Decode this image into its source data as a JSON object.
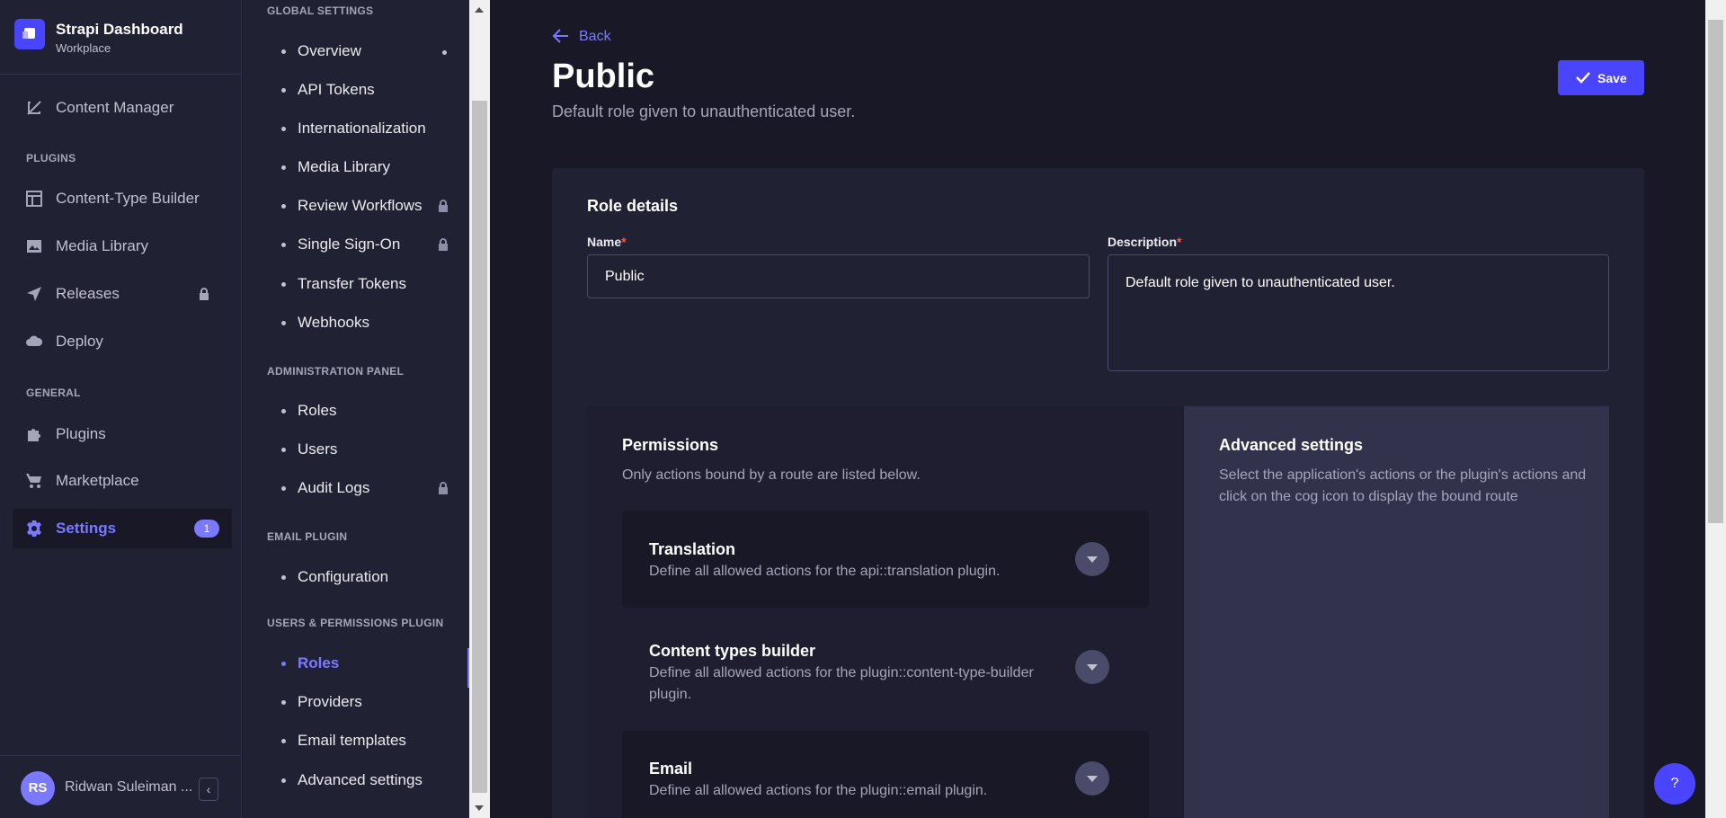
{
  "brand": {
    "title": "Strapi Dashboard",
    "subtitle": "Workplace"
  },
  "main_nav": {
    "content_manager": "Content Manager",
    "plugins_section": "PLUGINS",
    "content_type_builder": "Content-Type Builder",
    "media_library": "Media Library",
    "releases": "Releases",
    "deploy": "Deploy",
    "general_section": "GENERAL",
    "plugins": "Plugins",
    "marketplace": "Marketplace",
    "settings": "Settings",
    "settings_badge": "1"
  },
  "user": {
    "initials": "RS",
    "name": "Ridwan Suleiman ..."
  },
  "settings_nav": {
    "global_section": "GLOBAL SETTINGS",
    "overview": "Overview",
    "api_tokens": "API Tokens",
    "internationalization": "Internationalization",
    "media_library": "Media Library",
    "review_workflows": "Review Workflows",
    "single_sign_on": "Single Sign-On",
    "transfer_tokens": "Transfer Tokens",
    "webhooks": "Webhooks",
    "admin_section": "ADMINISTRATION PANEL",
    "roles": "Roles",
    "users": "Users",
    "audit_logs": "Audit Logs",
    "email_section": "EMAIL PLUGIN",
    "configuration": "Configuration",
    "up_section": "USERS & PERMISSIONS PLUGIN",
    "up_roles": "Roles",
    "providers": "Providers",
    "email_templates": "Email templates",
    "advanced_settings": "Advanced settings"
  },
  "page": {
    "back": "Back",
    "title": "Public",
    "subtitle": "Default role given to unauthenticated user.",
    "save": "Save"
  },
  "role_details": {
    "title": "Role details",
    "name_label": "Name",
    "name_value": "Public",
    "description_label": "Description",
    "description_value": "Default role given to unauthenticated user.",
    "required_mark": "*"
  },
  "permissions": {
    "title": "Permissions",
    "subtitle": "Only actions bound by a route are listed below.",
    "items": [
      {
        "title": "Translation",
        "description": "Define all allowed actions for the api::translation plugin."
      },
      {
        "title": "Content types builder",
        "description": "Define all allowed actions for the plugin::content-type-builder plugin."
      },
      {
        "title": "Email",
        "description": "Define all allowed actions for the plugin::email plugin."
      }
    ]
  },
  "advanced": {
    "title": "Advanced settings",
    "subtitle": "Select the application's actions or the plugin's actions and click on the cog icon to display the bound route"
  },
  "help": "?",
  "colors": {
    "primary": "#4945ff",
    "accent": "#7b79ff",
    "bg": "#181826",
    "panel": "#212134"
  }
}
